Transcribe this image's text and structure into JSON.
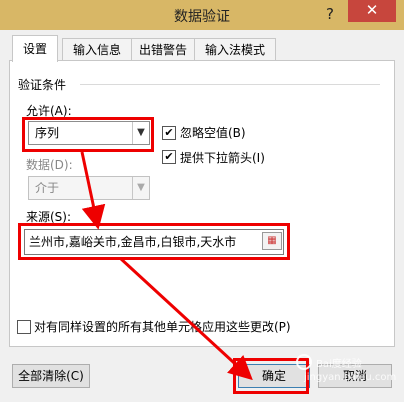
{
  "window": {
    "title": "数据验证",
    "help": "?",
    "close": "✕"
  },
  "tabs": [
    {
      "label": "设置",
      "active": true
    },
    {
      "label": "输入信息",
      "active": false
    },
    {
      "label": "出错警告",
      "active": false
    },
    {
      "label": "输入法模式",
      "active": false
    }
  ],
  "validation": {
    "group_title": "验证条件",
    "allow_label": "允许(A):",
    "allow_value": "序列",
    "ignore_blank_label": "忽略空值(B)",
    "ignore_blank_checked": true,
    "dropdown_label": "提供下拉箭头(I)",
    "dropdown_checked": true,
    "data_label": "数据(D):",
    "data_value": "介于",
    "source_label": "来源(S):",
    "source_value": "兰州市,嘉峪关市,金昌市,白银市,天水市"
  },
  "apply_all_label": "对有同样设置的所有其他单元格应用这些更改(P)",
  "buttons": {
    "clear_all": "全部清除(C)",
    "ok": "确定",
    "cancel": "取消"
  },
  "watermark": {
    "line1": "Bai度经验",
    "line2": "jingyan.baidu.com"
  },
  "colors": {
    "titlebar": "#d8b766",
    "close": "#c7463d",
    "annotation": "#e00000"
  }
}
